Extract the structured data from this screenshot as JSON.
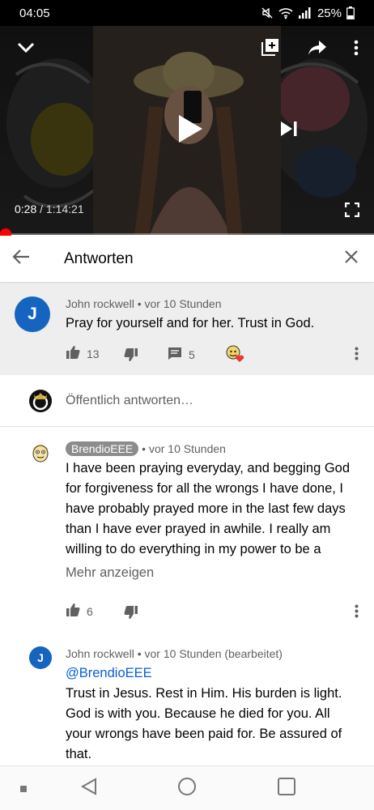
{
  "status_bar": {
    "time": "04:05",
    "battery": "25%"
  },
  "video": {
    "current_time": "0:28",
    "separator": "/",
    "duration": "1:14:21",
    "progress": 0.006
  },
  "replies_header": {
    "title": "Antworten"
  },
  "top_comment": {
    "avatar_letter": "J",
    "author": "John rockwell",
    "time": "vor 10 Stunden",
    "text": "Pray for yourself and for her. Trust in God.",
    "likes": "13",
    "replies": "5"
  },
  "reply_input": {
    "placeholder": "Öffentlich antworten…"
  },
  "replies": [
    {
      "author": "BrendioEEE",
      "time": "vor 10 Stunden",
      "text_lines": [
        "I have been praying everyday, and begging God",
        "for forgiveness for all the wrongs I have done, I",
        "have probably prayed more in the last few days",
        "than I have ever prayed in awhile. I really am",
        "willing to do everything in my power to be a"
      ],
      "show_more": "Mehr anzeigen",
      "likes": "6"
    },
    {
      "avatar_letter": "J",
      "author": "John rockwell",
      "time": "vor 10 Stunden (bearbeitet)",
      "mention": "@BrendioEEE",
      "text_lines": [
        "Trust in Jesus. Rest in Him. His burden is light.",
        "God is with you. Because he died for you. All",
        "your wrongs have been paid for. Be assured of",
        "that."
      ]
    }
  ],
  "colors": {
    "progress": "#ff0000",
    "avatar_blue": "#1565c0",
    "link": "#065fd4",
    "badge": "#8c8c8c"
  }
}
